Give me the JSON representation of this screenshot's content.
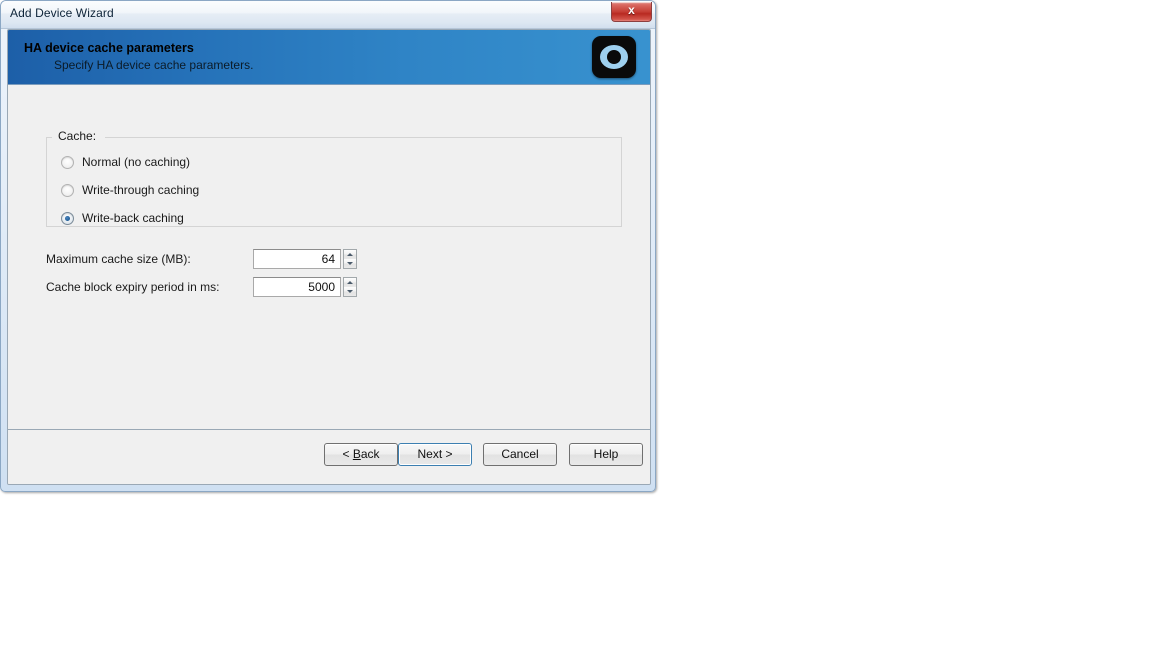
{
  "window": {
    "title": "Add Device Wizard",
    "close_label": "x"
  },
  "banner": {
    "title": "HA device cache parameters",
    "subtitle": "Specify HA device cache parameters.",
    "logo_icon": "eye-target-icon",
    "gradient_start": "#1d5fa8",
    "gradient_end": "#3892cf"
  },
  "cache_group": {
    "legend": "Cache:",
    "options": [
      {
        "label": "Normal (no caching)",
        "checked": false
      },
      {
        "label": "Write-through caching",
        "checked": false
      },
      {
        "label": "Write-back caching",
        "checked": true
      }
    ]
  },
  "fields": [
    {
      "label": "Maximum cache size (MB):",
      "value": "64",
      "spinner_up_icon": "triangle-up-icon",
      "spinner_down_icon": "triangle-down-icon"
    },
    {
      "label": "Cache block expiry period in ms:",
      "value": "5000",
      "spinner_up_icon": "triangle-up-icon",
      "spinner_down_icon": "triangle-down-icon"
    }
  ],
  "footer": {
    "back_label": "< Back",
    "back_accel": "B",
    "next_label": "Next >",
    "cancel_label": "Cancel",
    "help_label": "Help",
    "default_button": "Next >",
    "focus_color": "#3c7fb1"
  }
}
